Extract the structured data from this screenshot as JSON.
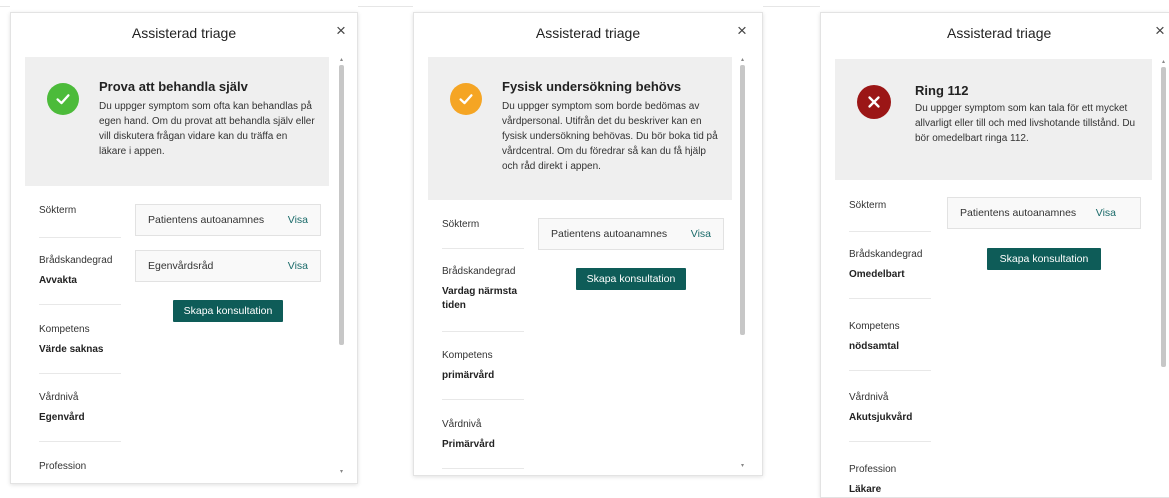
{
  "modals": [
    {
      "title": "Assisterad triage",
      "close_glyph": "×",
      "result": {
        "status": "ok",
        "title": "Prova att behandla själv",
        "description": "Du uppger symptom som ofta kan behandlas på egen hand. Om du provat att behandla själv eller vill diskutera frågan vidare kan du träffa en läkare i appen."
      },
      "info": [
        {
          "label": "Sökterm",
          "value": ""
        },
        {
          "label": "Brådskandegrad",
          "value": "Avvakta"
        },
        {
          "label": "Kompetens",
          "value": "Värde saknas"
        },
        {
          "label": "Vårdnivå",
          "value": "Egenvård"
        },
        {
          "label": "Profession",
          "value": ""
        }
      ],
      "rows": [
        {
          "label": "Patientens autoanamnes",
          "link": "Visa"
        },
        {
          "label": "Egenvårdsråd",
          "link": "Visa"
        }
      ],
      "button_label": "Skapa konsultation"
    },
    {
      "title": "Assisterad triage",
      "close_glyph": "×",
      "result": {
        "status": "warning",
        "title": "Fysisk undersökning behövs",
        "description": "Du uppger symptom som borde bedömas av vårdpersonal. Utifrån det du beskriver kan en fysisk undersökning behövas. Du bör boka tid på vårdcentral. Om du föredrar så kan du få hjälp och råd direkt i appen."
      },
      "info": [
        {
          "label": "Sökterm",
          "value": ""
        },
        {
          "label": "Brådskandegrad",
          "value": "Vardag närmsta tiden"
        },
        {
          "label": "Kompetens",
          "value": "primärvård"
        },
        {
          "label": "Vårdnivå",
          "value": "Primärvård"
        }
      ],
      "rows": [
        {
          "label": "Patientens autoanamnes",
          "link": "Visa"
        }
      ],
      "button_label": "Skapa konsultation"
    },
    {
      "title": "Assisterad triage",
      "close_glyph": "×",
      "result": {
        "status": "error",
        "title": "Ring 112",
        "description": "Du uppger symptom som kan tala för ett mycket allvarligt eller till och med livshotande tillstånd. Du bör omedelbart ringa 112."
      },
      "info": [
        {
          "label": "Sökterm",
          "value": ""
        },
        {
          "label": "Brådskandegrad",
          "value": "Omedelbart"
        },
        {
          "label": "Kompetens",
          "value": "nödsamtal"
        },
        {
          "label": "Vårdnivå",
          "value": "Akutsjukvård"
        },
        {
          "label": "Profession",
          "value": "Läkare"
        }
      ],
      "rows": [
        {
          "label": "Patientens autoanamnes",
          "link": "Visa"
        }
      ],
      "button_label": "Skapa konsultation"
    }
  ],
  "colors": {
    "primary": "#0e5c58",
    "link": "#1b6b6a",
    "ok": "#4cbb3a",
    "warning": "#f5a524",
    "error": "#9b1616",
    "result_bg": "#efefef"
  },
  "icons": {
    "ok": "checkmark-icon",
    "warning": "checkmark-icon",
    "error": "x-icon",
    "close": "close-icon"
  }
}
